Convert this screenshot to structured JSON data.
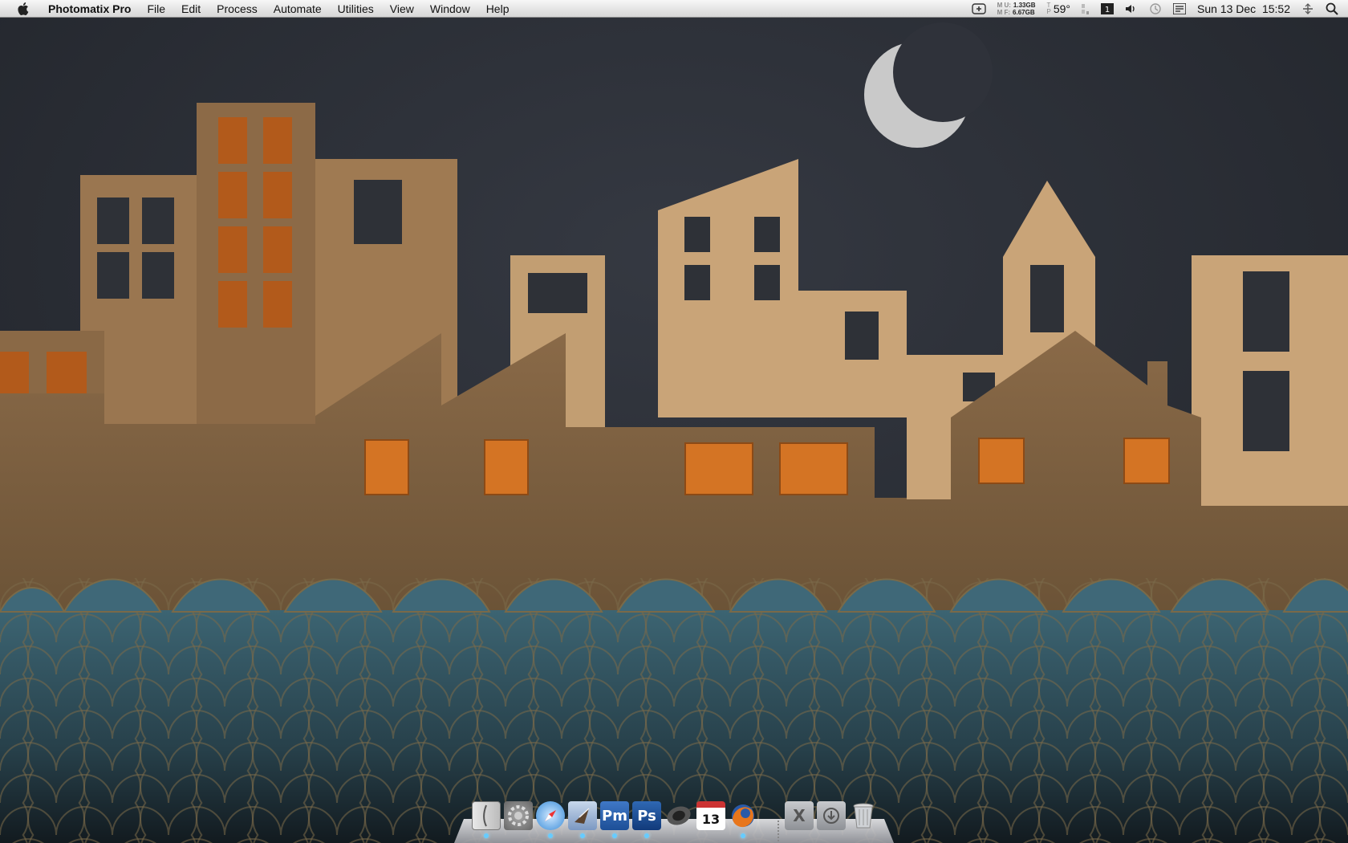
{
  "menubar": {
    "app_name": "Photomatix Pro",
    "menus": [
      "File",
      "Edit",
      "Process",
      "Automate",
      "Utilities",
      "View",
      "Window",
      "Help"
    ],
    "memory": {
      "u_label": "M U:",
      "u_value": "1.33GB",
      "f_label": "M F:",
      "f_value": "6.67GB"
    },
    "temp": "59°",
    "clock": "Sun 13 Dec  15:52"
  },
  "dock": {
    "items": [
      {
        "name": "Finder",
        "icon": "finder-icon"
      },
      {
        "name": "System Preferences",
        "icon": "system-preferences-icon"
      },
      {
        "name": "Safari",
        "icon": "safari-icon"
      },
      {
        "name": "Mail",
        "icon": "mail-icon"
      },
      {
        "name": "Photomatix Pro",
        "icon": "photomatix-icon",
        "text": "Pm"
      },
      {
        "name": "Photoshop",
        "icon": "photoshop-icon",
        "text": "Ps"
      },
      {
        "name": "Speakers",
        "icon": "speaker-icon"
      },
      {
        "name": "iCal",
        "icon": "calendar-icon",
        "text": "13"
      },
      {
        "name": "Firefox",
        "icon": "firefox-icon"
      },
      {
        "name": "Applications",
        "icon": "applications-folder-icon",
        "text": "X"
      },
      {
        "name": "Downloads",
        "icon": "downloads-folder-icon"
      },
      {
        "name": "Trash",
        "icon": "trash-icon"
      }
    ]
  },
  "colors": {
    "sky": "#2b2e35",
    "building_light": "#c29e72",
    "building_dark": "#7a5e42",
    "window_lit": "#cc6a20",
    "water": "#3a5c68"
  }
}
